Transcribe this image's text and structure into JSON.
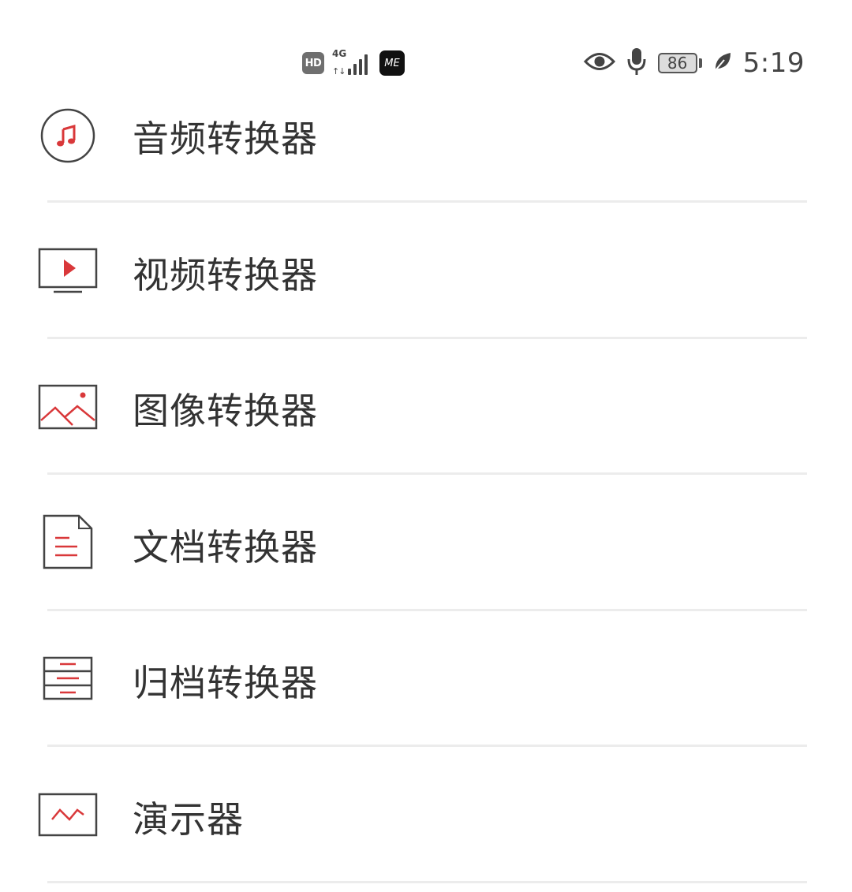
{
  "status_bar": {
    "hd_label": "HD",
    "network_label": "4G",
    "network_arrows": "↑↓",
    "app_badge_label": "ME",
    "battery_level": "86",
    "time": "5:19",
    "icons": [
      "hd-icon",
      "signal-icon",
      "app-notification-icon",
      "eye-comfort-icon",
      "microphone-icon",
      "battery-icon",
      "power-saving-leaf-icon"
    ]
  },
  "menu": {
    "items": [
      {
        "label": "音频转换器",
        "icon": "music-note-icon"
      },
      {
        "label": "视频转换器",
        "icon": "video-play-icon"
      },
      {
        "label": "图像转换器",
        "icon": "image-mountain-icon"
      },
      {
        "label": "文档转换器",
        "icon": "document-icon"
      },
      {
        "label": "归档转换器",
        "icon": "archive-icon"
      },
      {
        "label": "演示器",
        "icon": "presentation-chart-icon"
      }
    ]
  },
  "colors": {
    "accent": "#d9383a",
    "icon_outline": "#444444",
    "text": "#333333",
    "divider": "#ececec",
    "background": "#ffffff"
  }
}
